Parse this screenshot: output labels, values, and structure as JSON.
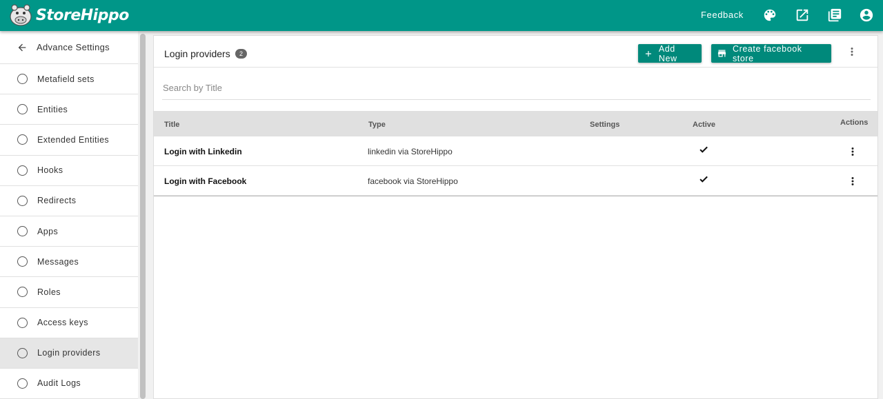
{
  "header": {
    "brand": "StoreHippo",
    "feedback_label": "Feedback",
    "icons": [
      "palette-icon",
      "open-external-icon",
      "library-icon",
      "account-circle-icon"
    ]
  },
  "sidebar": {
    "back_label": "Advance Settings",
    "items": [
      {
        "label": "Metafield sets",
        "active": false
      },
      {
        "label": "Entities",
        "active": false
      },
      {
        "label": "Extended Entities",
        "active": false
      },
      {
        "label": "Hooks",
        "active": false
      },
      {
        "label": "Redirects",
        "active": false
      },
      {
        "label": "Apps",
        "active": false
      },
      {
        "label": "Messages",
        "active": false
      },
      {
        "label": "Roles",
        "active": false
      },
      {
        "label": "Access keys",
        "active": false
      },
      {
        "label": "Login providers",
        "active": true
      },
      {
        "label": "Audit Logs",
        "active": false
      }
    ]
  },
  "main": {
    "title": "Login providers",
    "count": "2",
    "add_new_label": "Add New",
    "create_fb_label": "Create facebook store",
    "search_placeholder": "Search by Title",
    "columns": {
      "title": "Title",
      "type": "Type",
      "settings": "Settings",
      "active": "Active",
      "actions": "Actions"
    },
    "rows": [
      {
        "title": "Login with Linkedin",
        "type": "linkedin via StoreHippo",
        "active": true
      },
      {
        "title": "Login with Facebook",
        "type": "facebook via StoreHippo",
        "active": true
      }
    ]
  },
  "colors": {
    "primary": "#009688",
    "button": "#00897b"
  }
}
